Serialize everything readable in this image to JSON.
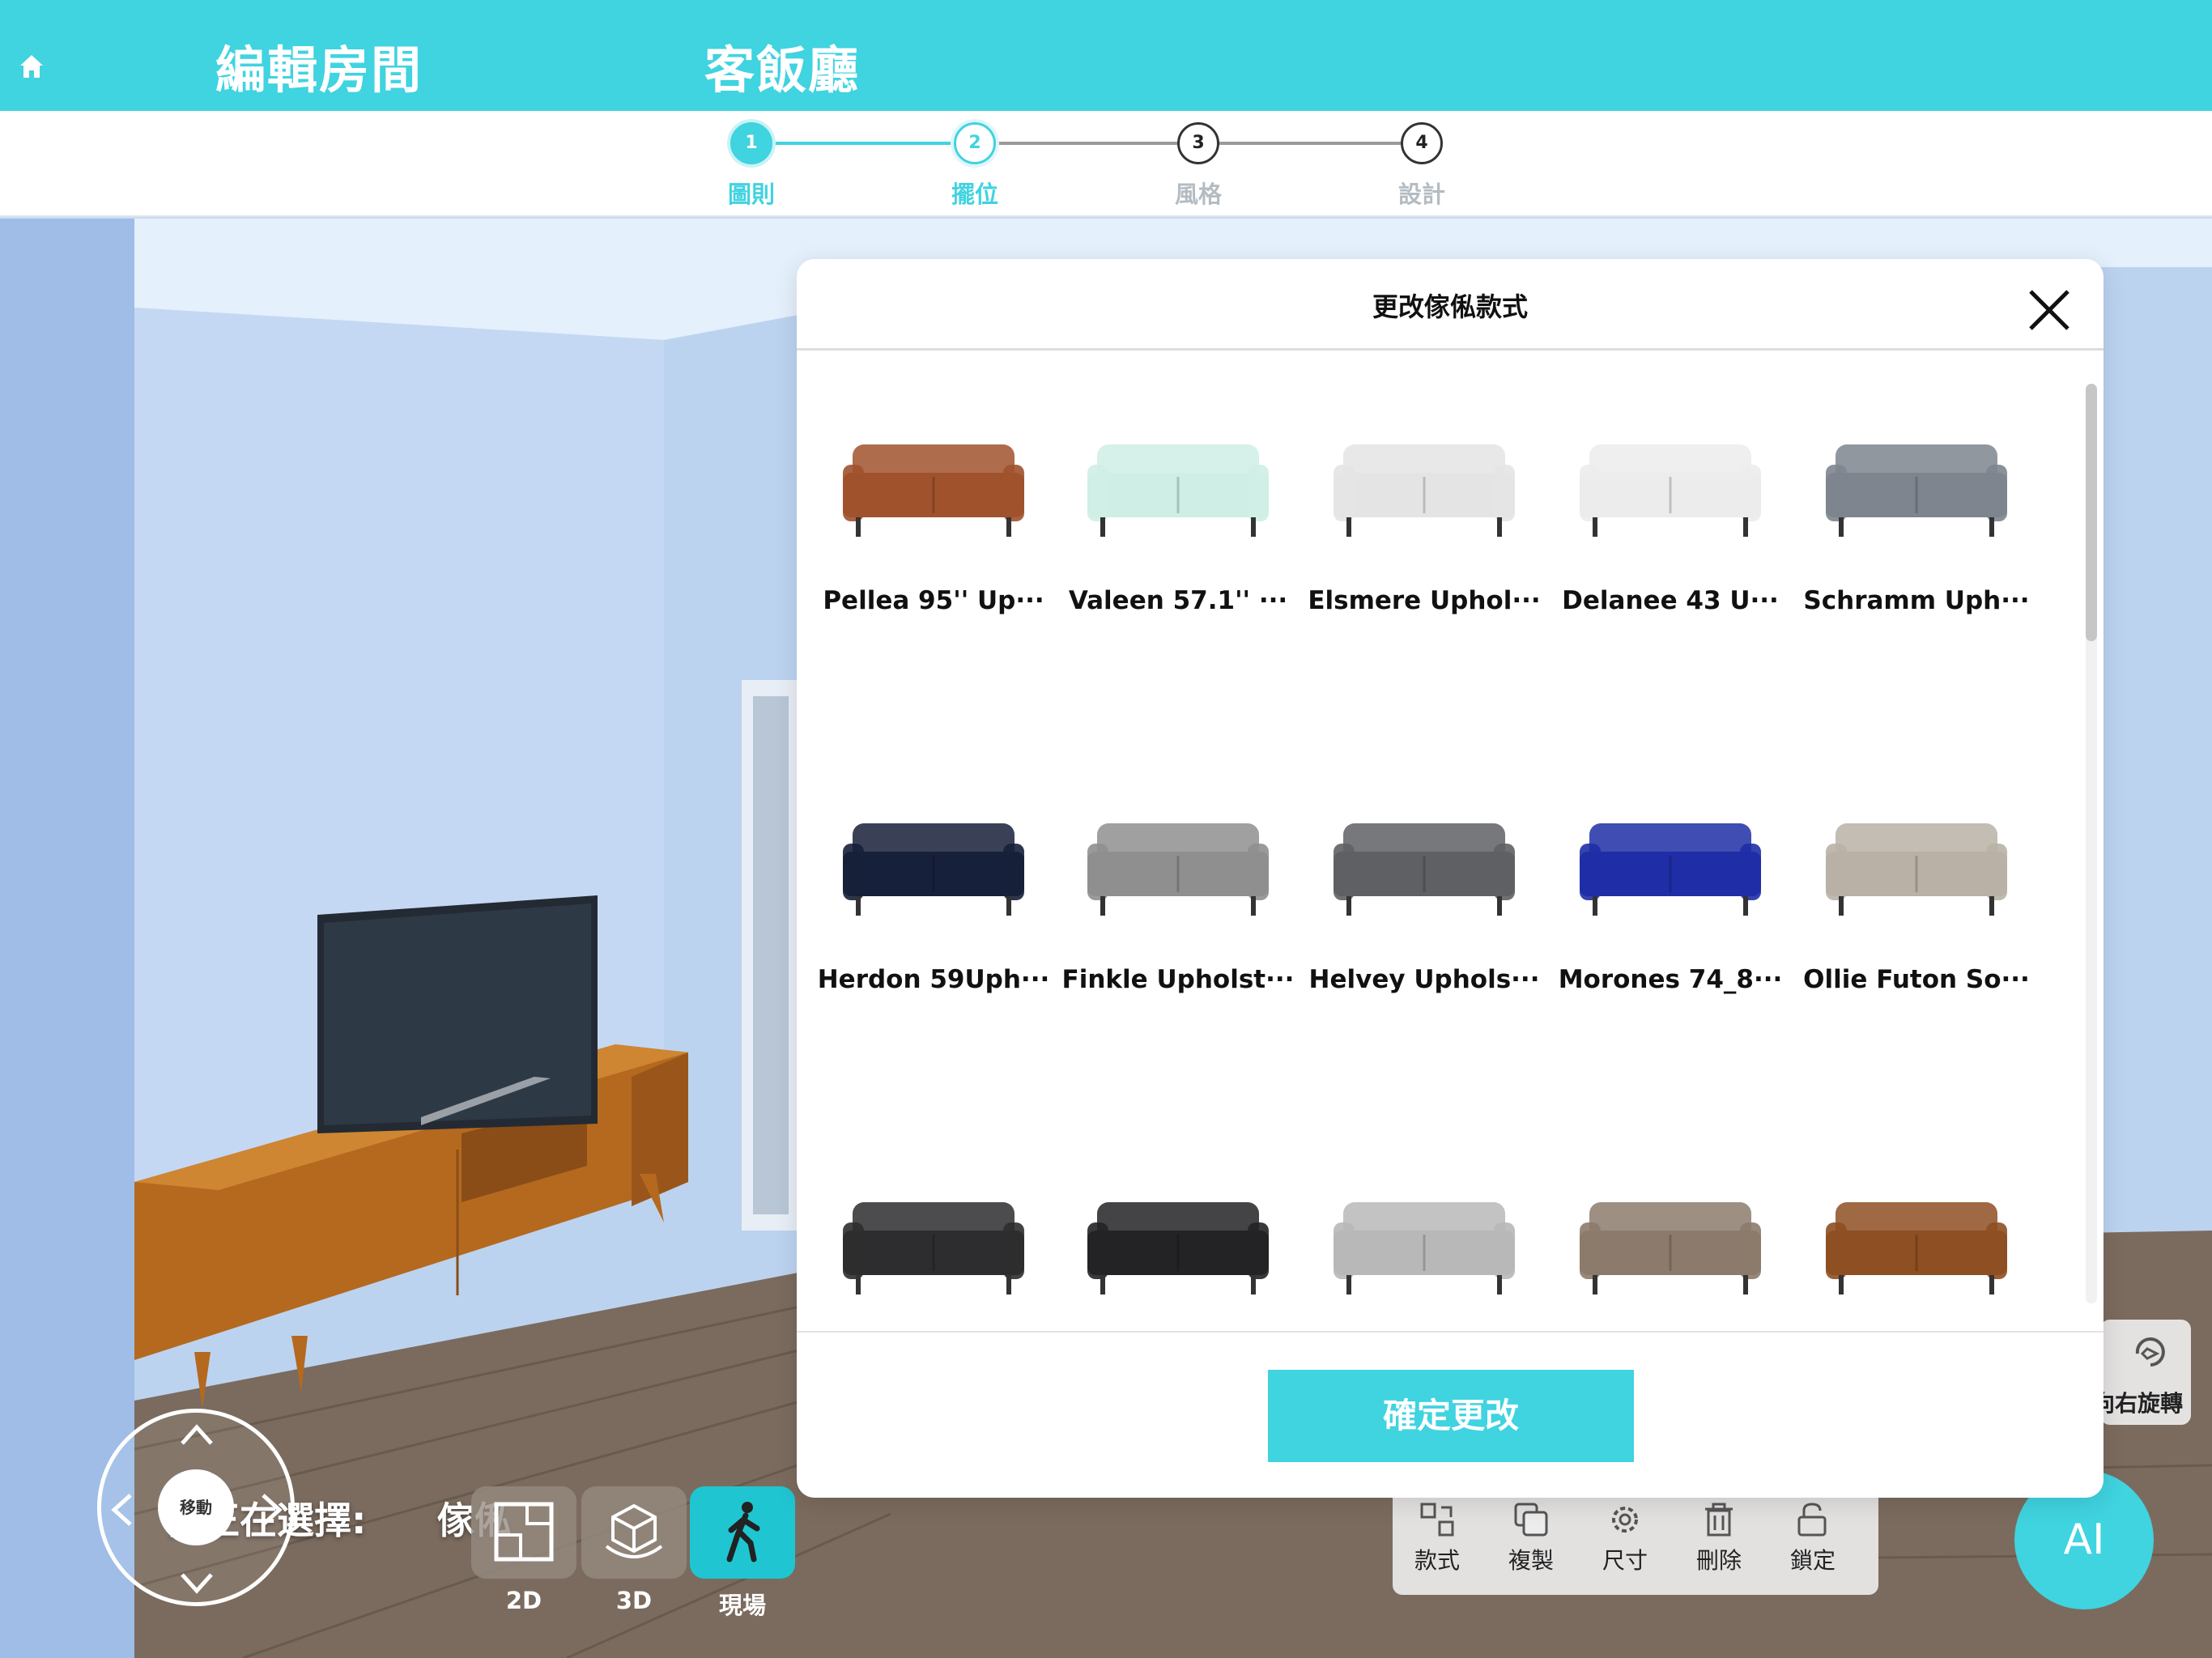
{
  "header": {
    "title": "編輯房間",
    "room_name": "客飯廳"
  },
  "stepper": {
    "steps": [
      {
        "number": "1",
        "label": "圖則"
      },
      {
        "number": "2",
        "label": "擺位"
      },
      {
        "number": "3",
        "label": "風格"
      },
      {
        "number": "4",
        "label": "設計"
      }
    ],
    "current_step": 2
  },
  "scene": {
    "selection_label": "你正在選擇:",
    "selection_value": "傢俬",
    "joystick_label": "移動",
    "view_modes": [
      "2D",
      "3D",
      "現場"
    ],
    "active_view": "現場",
    "rotate_label": "向右旋轉",
    "ai_label": "AI"
  },
  "toolbar": {
    "items": [
      {
        "label": "款式",
        "icon": "style-icon"
      },
      {
        "label": "複製",
        "icon": "copy-icon"
      },
      {
        "label": "尺寸",
        "icon": "gear-icon"
      },
      {
        "label": "刪除",
        "icon": "trash-icon"
      },
      {
        "label": "鎖定",
        "icon": "unlock-icon"
      }
    ]
  },
  "modal": {
    "title": "更改傢俬款式",
    "confirm_label": "確定更改",
    "items": [
      {
        "name": "Pellea 95'' Up···",
        "color": "#a0522d"
      },
      {
        "name": "Valeen 57.1'' ···",
        "color": "#cfeee6"
      },
      {
        "name": "Elsmere Uphol···",
        "color": "#e4e4e4"
      },
      {
        "name": "Delanee 43 U···",
        "color": "#ececec"
      },
      {
        "name": "Schramm Uph···",
        "color": "#7e858e"
      },
      {
        "name": "Herdon 59Uph···",
        "color": "#17203a"
      },
      {
        "name": "Finkle Upholst···",
        "color": "#8f8f8f"
      },
      {
        "name": "Helvey Uphols···",
        "color": "#5f6064"
      },
      {
        "name": "Morones 74_8···",
        "color": "#1f2ea6"
      },
      {
        "name": "Ollie Futon So···",
        "color": "#b9b1a6"
      },
      {
        "name": "",
        "color": "#2d2d2f"
      },
      {
        "name": "",
        "color": "#232326"
      },
      {
        "name": "",
        "color": "#b8b8b8"
      },
      {
        "name": "",
        "color": "#8c7b6c"
      },
      {
        "name": "",
        "color": "#8e4f22"
      }
    ]
  },
  "colors": {
    "accent": "#40d3e0",
    "wood_floor": "#7f6f62",
    "tv_stand": "#b4691f"
  }
}
